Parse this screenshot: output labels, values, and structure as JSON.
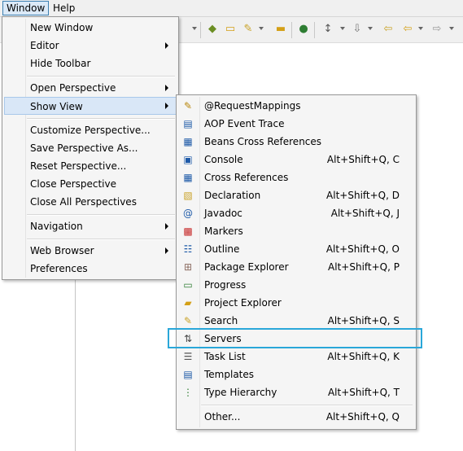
{
  "menubar": {
    "window": "Window",
    "help": "Help"
  },
  "window_menu": {
    "items": [
      {
        "label": "New Window"
      },
      {
        "label": "Editor"
      },
      {
        "label": "Hide Toolbar"
      },
      {
        "label": "Open Perspective"
      },
      {
        "label": "Show View"
      },
      {
        "label": "Customize Perspective..."
      },
      {
        "label": "Save Perspective As..."
      },
      {
        "label": "Reset Perspective..."
      },
      {
        "label": "Close Perspective"
      },
      {
        "label": "Close All Perspectives"
      },
      {
        "label": "Navigation"
      },
      {
        "label": "Web Browser"
      },
      {
        "label": "Preferences"
      }
    ]
  },
  "show_view_menu": {
    "items": [
      {
        "label": "@RequestMappings",
        "shortcut": "",
        "icon": "request-mappings-icon"
      },
      {
        "label": "AOP Event Trace",
        "shortcut": "",
        "icon": "aop-trace-icon"
      },
      {
        "label": "Beans Cross References",
        "shortcut": "",
        "icon": "beans-xref-icon"
      },
      {
        "label": "Console",
        "shortcut": "Alt+Shift+Q, C",
        "icon": "console-icon"
      },
      {
        "label": "Cross References",
        "shortcut": "",
        "icon": "cross-references-icon"
      },
      {
        "label": "Declaration",
        "shortcut": "Alt+Shift+Q, D",
        "icon": "declaration-icon"
      },
      {
        "label": "Javadoc",
        "shortcut": "Alt+Shift+Q, J",
        "icon": "javadoc-icon"
      },
      {
        "label": "Markers",
        "shortcut": "",
        "icon": "markers-icon"
      },
      {
        "label": "Outline",
        "shortcut": "Alt+Shift+Q, O",
        "icon": "outline-icon"
      },
      {
        "label": "Package Explorer",
        "shortcut": "Alt+Shift+Q, P",
        "icon": "package-explorer-icon"
      },
      {
        "label": "Progress",
        "shortcut": "",
        "icon": "progress-icon"
      },
      {
        "label": "Project Explorer",
        "shortcut": "",
        "icon": "project-explorer-icon"
      },
      {
        "label": "Search",
        "shortcut": "Alt+Shift+Q, S",
        "icon": "search-icon"
      },
      {
        "label": "Servers",
        "shortcut": "",
        "icon": "servers-icon"
      },
      {
        "label": "Task List",
        "shortcut": "Alt+Shift+Q, K",
        "icon": "task-list-icon"
      },
      {
        "label": "Templates",
        "shortcut": "",
        "icon": "templates-icon"
      },
      {
        "label": "Type Hierarchy",
        "shortcut": "Alt+Shift+Q, T",
        "icon": "type-hierarchy-icon"
      },
      {
        "label": "Other...",
        "shortcut": "Alt+Shift+Q, Q",
        "icon": ""
      }
    ]
  },
  "colors": {
    "highlight": "#d9e7f7",
    "callout": "#2aa7d9"
  }
}
